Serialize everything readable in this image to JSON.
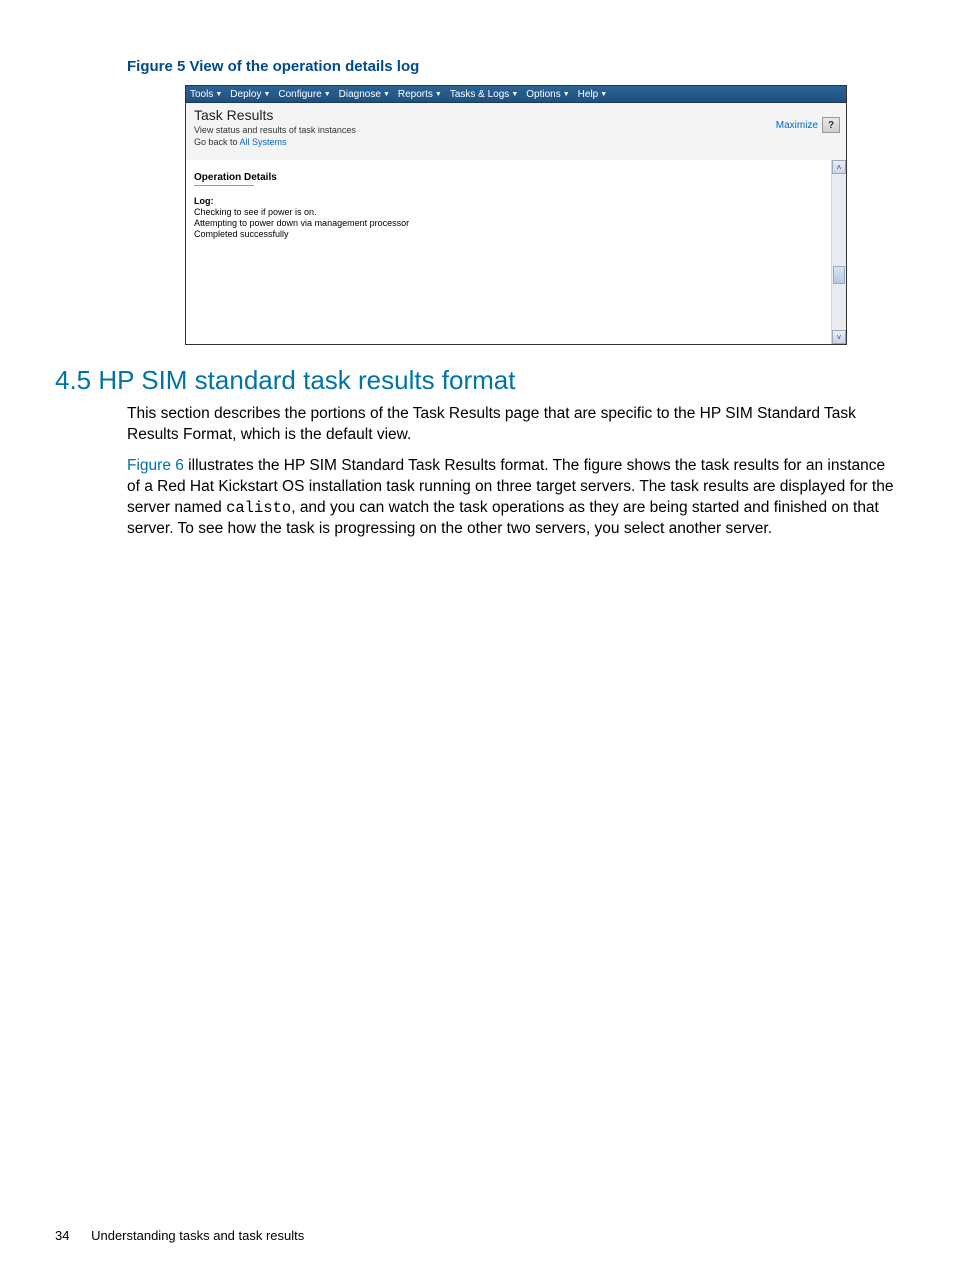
{
  "figure_caption": "Figure 5 View of the operation details log",
  "screenshot": {
    "menu": {
      "items": [
        "Tools",
        "Deploy",
        "Configure",
        "Diagnose",
        "Reports",
        "Tasks & Logs",
        "Options",
        "Help"
      ]
    },
    "header": {
      "title": "Task Results",
      "subtitle": "View status and results of task instances",
      "goback_label": "Go back to ",
      "goback_link": "All Systems",
      "maximize": "Maximize",
      "help_symbol": "?"
    },
    "details": {
      "pane_title": "Operation Details",
      "log_label": "Log:",
      "lines": [
        "Checking to see if power is on.",
        "Attempting to power down via management processor",
        "Completed successfully"
      ]
    }
  },
  "section": {
    "title": "4.5 HP SIM standard task results format",
    "para1": "This section describes the portions of the Task Results page that are specific to the HP SIM Standard Task Results Format, which is the default view.",
    "para2_link": "Figure 6",
    "para2_a": " illustrates the HP SIM Standard Task Results format. The figure shows the task results for an instance of a Red Hat Kickstart OS installation task running on three target servers. The task results are displayed for the server named ",
    "para2_code": "calisto",
    "para2_b": ", and you can watch the task operations as they are being started and finished on that server. To see how the task is progressing on the other two servers, you select another server."
  },
  "footer": {
    "page_number": "34",
    "chapter": "Understanding tasks and task results"
  }
}
